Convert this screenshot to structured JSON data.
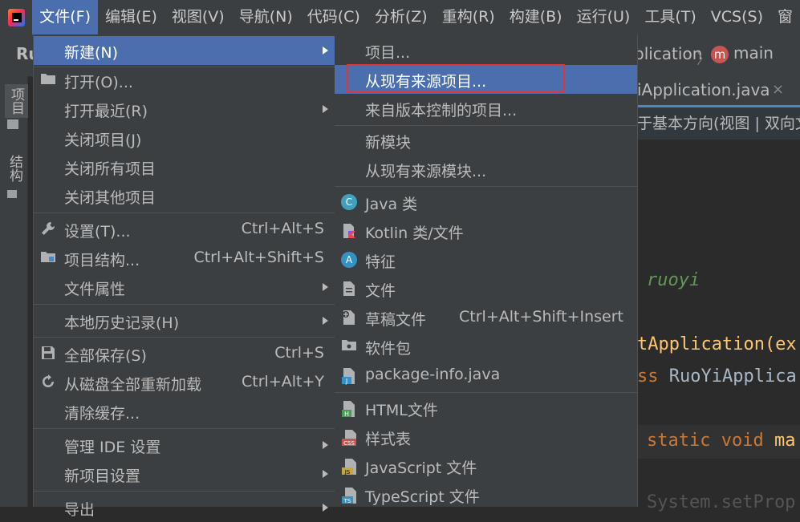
{
  "menubar": {
    "items": [
      {
        "label": "文件(F)"
      },
      {
        "label": "编辑(E)"
      },
      {
        "label": "视图(V)"
      },
      {
        "label": "导航(N)"
      },
      {
        "label": "代码(C)"
      },
      {
        "label": "分析(Z)"
      },
      {
        "label": "重构(R)"
      },
      {
        "label": "构建(B)"
      },
      {
        "label": "运行(U)"
      },
      {
        "label": "工具(T)"
      },
      {
        "label": "VCS(S)"
      },
      {
        "label": "窗"
      }
    ]
  },
  "background": {
    "project_short": "Ru",
    "breadcrumb_partial": "plication",
    "module_letter": "m",
    "branch": "main",
    "left_tabs": {
      "project": "项目",
      "structure": "结构"
    },
    "editor_tab": "iApplication.java",
    "editor_tab_close": "×",
    "info_bar": "于基本方向(视图 | 双向文",
    "code": {
      "comment": "ruoyi",
      "annotation": "tApplication(ex",
      "class_kw": "ss",
      "class_name": " RuoYiApplica",
      "method_kw": "static void",
      "method_name": " ma",
      "last_line": "System.setProp"
    }
  },
  "file_menu": {
    "items": [
      {
        "label": "新建(N)",
        "icon": "",
        "shortcut": "",
        "submenu": true
      },
      {
        "label": "打开(O)...",
        "icon": "folder-icon",
        "shortcut": "",
        "submenu": false
      },
      {
        "label": "打开最近(R)",
        "icon": "",
        "shortcut": "",
        "submenu": true
      },
      {
        "label": "关闭项目(J)",
        "icon": "",
        "shortcut": "",
        "submenu": false
      },
      {
        "label": "关闭所有项目",
        "icon": "",
        "shortcut": "",
        "submenu": false
      },
      {
        "label": "关闭其他项目",
        "icon": "",
        "shortcut": "",
        "submenu": false
      },
      {
        "label": "设置(T)...",
        "icon": "wrench-icon",
        "shortcut": "Ctrl+Alt+S",
        "submenu": false
      },
      {
        "label": "项目结构...",
        "icon": "project-structure-icon",
        "shortcut": "Ctrl+Alt+Shift+S",
        "submenu": false
      },
      {
        "label": "文件属性",
        "icon": "",
        "shortcut": "",
        "submenu": true
      },
      {
        "label": "本地历史记录(H)",
        "icon": "",
        "shortcut": "",
        "submenu": true
      },
      {
        "label": "全部保存(S)",
        "icon": "save-icon",
        "shortcut": "Ctrl+S",
        "submenu": false
      },
      {
        "label": "从磁盘全部重新加载",
        "icon": "reload-icon",
        "shortcut": "Ctrl+Alt+Y",
        "submenu": false
      },
      {
        "label": "清除缓存...",
        "icon": "",
        "shortcut": "",
        "submenu": false
      },
      {
        "label": "管理 IDE 设置",
        "icon": "",
        "shortcut": "",
        "submenu": true
      },
      {
        "label": "新项目设置",
        "icon": "",
        "shortcut": "",
        "submenu": true
      },
      {
        "label": "导出",
        "icon": "",
        "shortcut": "",
        "submenu": true
      }
    ]
  },
  "new_submenu": {
    "items": [
      {
        "label": "项目...",
        "icon": "",
        "shortcut": ""
      },
      {
        "label": "从现有来源项目...",
        "icon": "",
        "shortcut": "",
        "highlighted": true,
        "callout": true
      },
      {
        "label": "来自版本控制的项目...",
        "icon": "",
        "shortcut": ""
      },
      {
        "label": "新模块",
        "icon": "",
        "shortcut": ""
      },
      {
        "label": "从现有来源模块...",
        "icon": "",
        "shortcut": ""
      },
      {
        "label": "Java 类",
        "icon": "java-class-icon",
        "icon_text": "C",
        "shortcut": ""
      },
      {
        "label": "Kotlin 类/文件",
        "icon": "kotlin-file-icon",
        "shortcut": ""
      },
      {
        "label": "特征",
        "icon": "aspect-icon",
        "icon_text": "A",
        "shortcut": ""
      },
      {
        "label": "文件",
        "icon": "file-icon",
        "shortcut": ""
      },
      {
        "label": "草稿文件",
        "icon": "scratch-file-icon",
        "shortcut": "Ctrl+Alt+Shift+Insert"
      },
      {
        "label": "软件包",
        "icon": "package-icon",
        "shortcut": ""
      },
      {
        "label": "package-info.java",
        "icon": "java-file-icon",
        "icon_text": "J",
        "shortcut": ""
      },
      {
        "label": "HTML文件",
        "icon": "html-file-icon",
        "icon_text": "H",
        "shortcut": ""
      },
      {
        "label": "样式表",
        "icon": "css-file-icon",
        "icon_text": "CSS",
        "shortcut": ""
      },
      {
        "label": "JavaScript 文件",
        "icon": "javascript-file-icon",
        "icon_text": "JS",
        "shortcut": ""
      },
      {
        "label": "TypeScript 文件",
        "icon": "typescript-file-icon",
        "icon_text": "TS",
        "shortcut": ""
      }
    ]
  },
  "colors": {
    "menu_bg": "#3c3f41",
    "highlight": "#4b6eaf",
    "editor_bg": "#2b2b2b",
    "callout_border": "#e0353b"
  }
}
